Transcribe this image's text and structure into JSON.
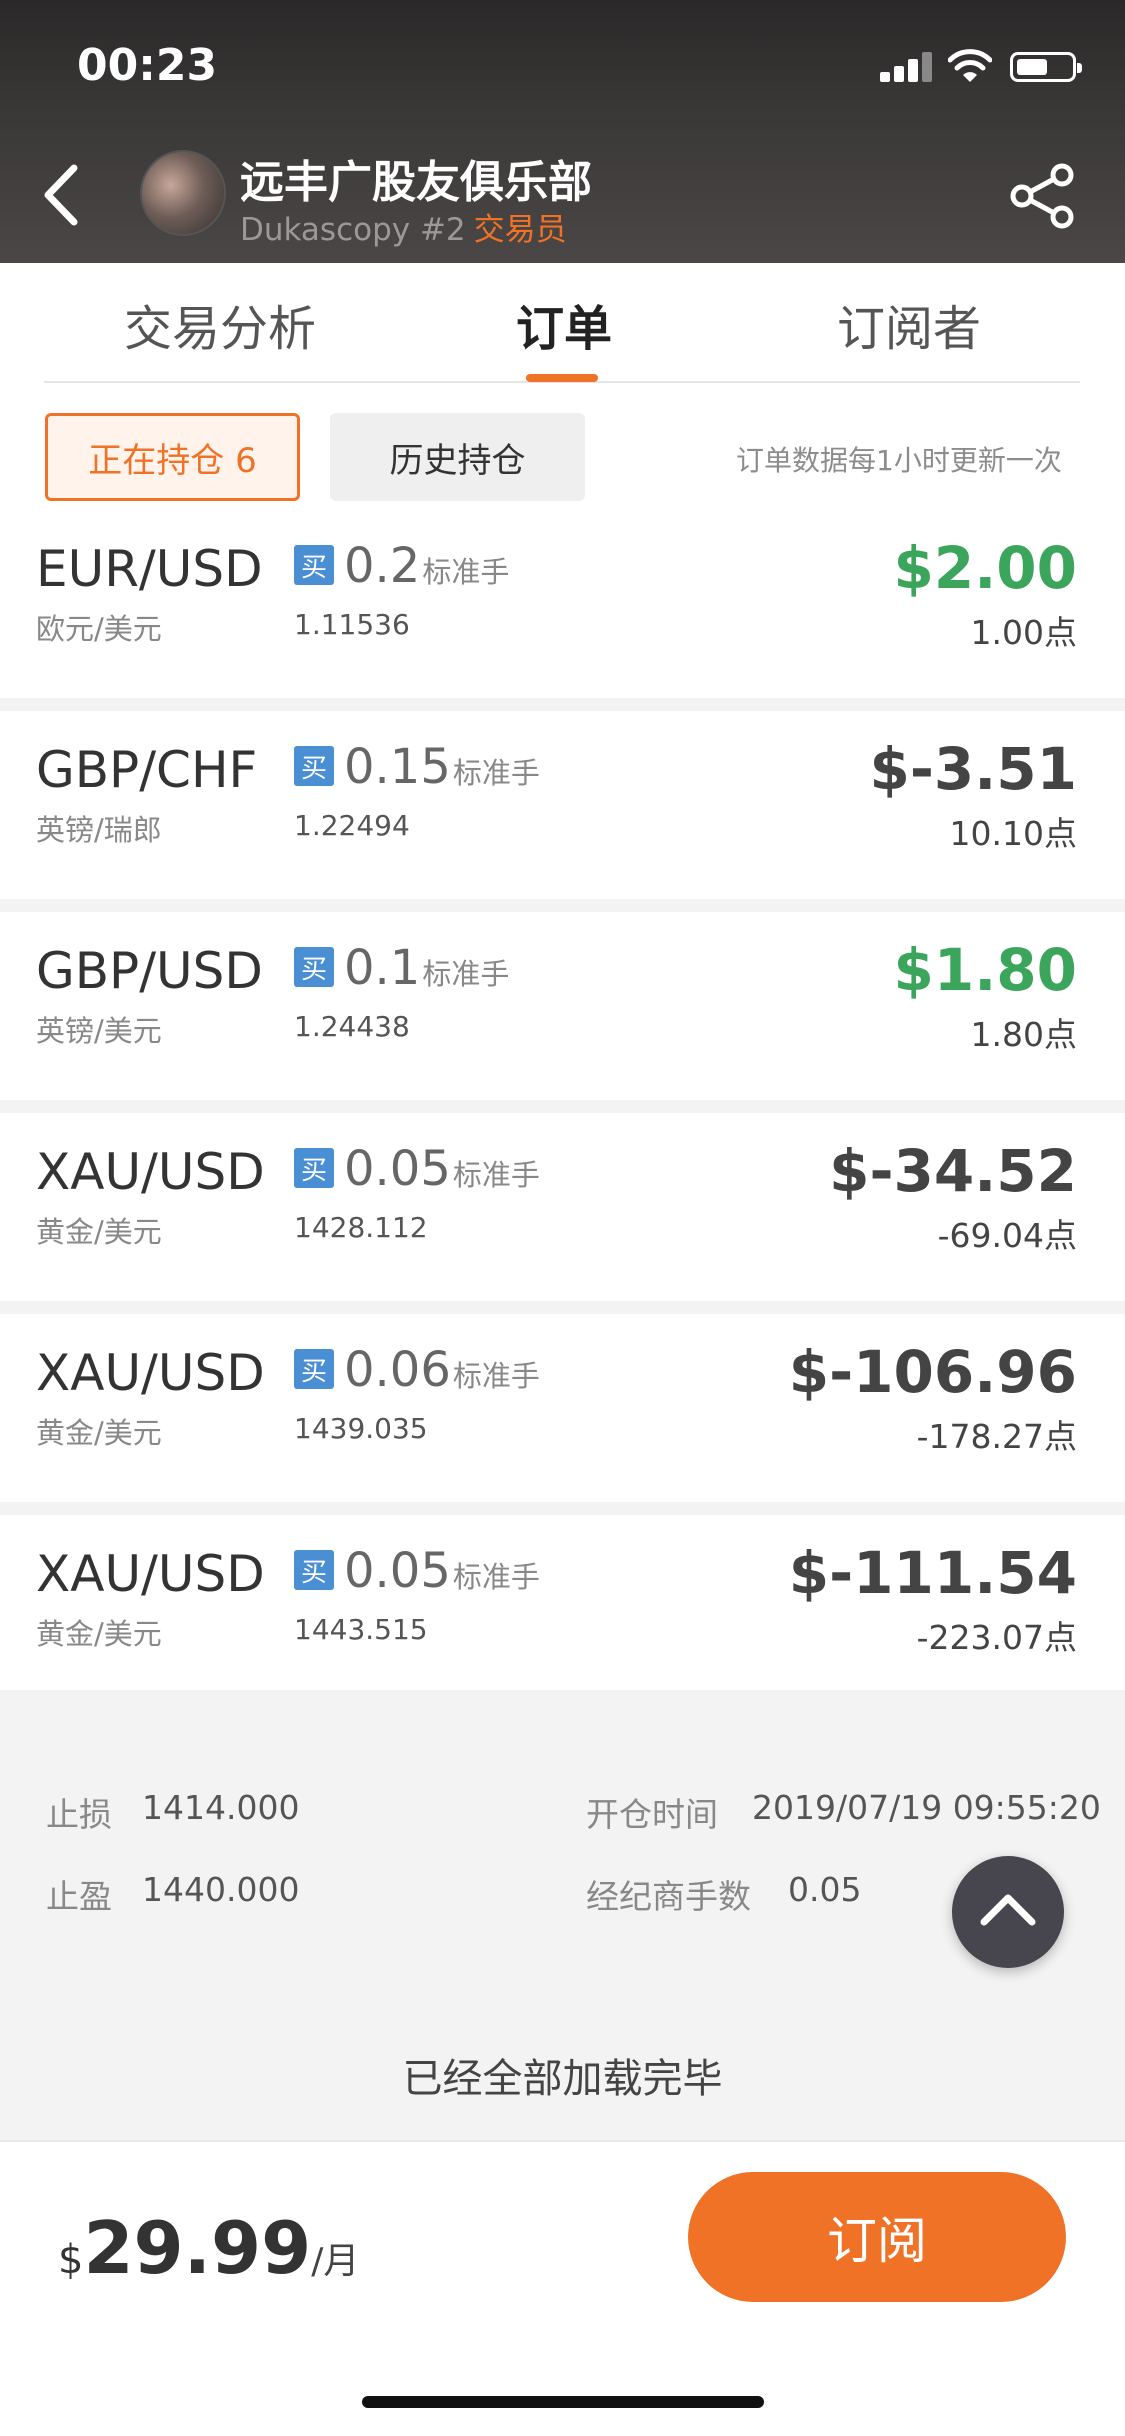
{
  "status_bar": {
    "time": "00:23"
  },
  "header": {
    "club_name": "远丰广股友俱乐部",
    "subtitle": "Dukascopy #2",
    "role": "交易员",
    "accent_color": "#f07227"
  },
  "tabs": [
    {
      "label": "交易分析",
      "active": false
    },
    {
      "label": "订单",
      "active": true
    },
    {
      "label": "订阅者",
      "active": false
    }
  ],
  "filters": {
    "open_label": "正在持仓 6",
    "history_label": "历史持仓",
    "note": "订单数据每1小时更新一次"
  },
  "orders": [
    {
      "pair": "EUR/USD",
      "pair_cn": "欧元/美元",
      "side": "买",
      "lots": "0.2",
      "lot_unit": "标准手",
      "price": "1.11536",
      "pnl": "$2.00",
      "points": "1.00点",
      "positive": true
    },
    {
      "pair": "GBP/CHF",
      "pair_cn": "英镑/瑞郎",
      "side": "买",
      "lots": "0.15",
      "lot_unit": "标准手",
      "price": "1.22494",
      "pnl": "$-3.51",
      "points": "10.10点",
      "positive": false
    },
    {
      "pair": "GBP/USD",
      "pair_cn": "英镑/美元",
      "side": "买",
      "lots": "0.1",
      "lot_unit": "标准手",
      "price": "1.24438",
      "pnl": "$1.80",
      "points": "1.80点",
      "positive": true
    },
    {
      "pair": "XAU/USD",
      "pair_cn": "黄金/美元",
      "side": "买",
      "lots": "0.05",
      "lot_unit": "标准手",
      "price": "1428.112",
      "pnl": "$-34.52",
      "points": "-69.04点",
      "positive": false
    },
    {
      "pair": "XAU/USD",
      "pair_cn": "黄金/美元",
      "side": "买",
      "lots": "0.06",
      "lot_unit": "标准手",
      "price": "1439.035",
      "pnl": "$-106.96",
      "points": "-178.27点",
      "positive": false
    },
    {
      "pair": "XAU/USD",
      "pair_cn": "黄金/美元",
      "side": "买",
      "lots": "0.05",
      "lot_unit": "标准手",
      "price": "1443.515",
      "pnl": "$-111.54",
      "points": "-223.07点",
      "positive": false
    }
  ],
  "detail": {
    "stop_loss_label": "止损",
    "stop_loss": "1414.000",
    "take_profit_label": "止盈",
    "take_profit": "1440.000",
    "open_time_label": "开仓时间",
    "open_time": "2019/07/19 09:55:20",
    "broker_lots_label": "经纪商手数",
    "broker_lots": "0.05"
  },
  "footer_note": "已经全部加载完毕",
  "subscription": {
    "currency": "$",
    "amount": "29.99",
    "unit": "/月",
    "button_label": "订阅"
  }
}
